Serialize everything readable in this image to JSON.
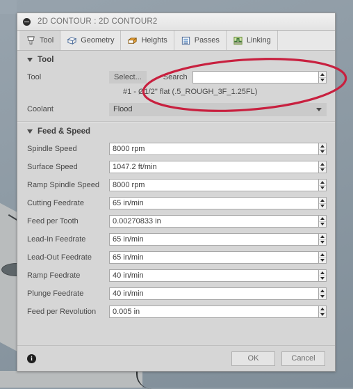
{
  "window": {
    "title": "2D CONTOUR : 2D CONTOUR2",
    "collapse_icon": "circle-minus-icon"
  },
  "tabs": [
    {
      "label": "Tool",
      "icon": "tool-endmill-icon",
      "active": true
    },
    {
      "label": "Geometry",
      "icon": "geometry-cube-icon",
      "active": false
    },
    {
      "label": "Heights",
      "icon": "heights-block-icon",
      "active": false
    },
    {
      "label": "Passes",
      "icon": "passes-layers-icon",
      "active": false
    },
    {
      "label": "Linking",
      "icon": "linking-step-icon",
      "active": false
    }
  ],
  "sections": {
    "tool": {
      "title": "Tool",
      "expanded_icon": "triangle-down-icon",
      "tool_row_label": "Tool",
      "select_button": "Select...",
      "search_label": "Search",
      "search_value": "",
      "search_placeholder": "",
      "tool_description": "#1 - Ø1/2\" flat (.5_ROUGH_3F_1.25FL)",
      "coolant_label": "Coolant",
      "coolant_value": "Flood"
    },
    "feed_speed": {
      "title": "Feed & Speed",
      "expanded_icon": "triangle-down-icon",
      "fields": [
        {
          "label": "Spindle Speed",
          "value": "8000 rpm"
        },
        {
          "label": "Surface Speed",
          "value": "1047.2 ft/min"
        },
        {
          "label": "Ramp Spindle Speed",
          "value": "8000 rpm"
        },
        {
          "label": "Cutting Feedrate",
          "value": "65 in/min"
        },
        {
          "label": "Feed per Tooth",
          "value": "0.00270833 in"
        },
        {
          "label": "Lead-In Feedrate",
          "value": "65 in/min"
        },
        {
          "label": "Lead-Out Feedrate",
          "value": "65 in/min"
        },
        {
          "label": "Ramp Feedrate",
          "value": "40 in/min"
        },
        {
          "label": "Plunge Feedrate",
          "value": "40 in/min"
        },
        {
          "label": "Feed per Revolution",
          "value": "0.005 in"
        }
      ]
    }
  },
  "footer": {
    "info_icon": "info-icon",
    "info_glyph": "i",
    "ok_label": "OK",
    "cancel_label": "Cancel"
  },
  "annotation": {
    "shape": "ellipse-highlight",
    "color": "#C8203F",
    "stroke_width": 3
  },
  "colors": {
    "dialog_bg": "#d6d6d6",
    "viewport_bg": "#8e9ba5",
    "field_bg": "#ffffff",
    "annotation_red": "#C8203F"
  }
}
